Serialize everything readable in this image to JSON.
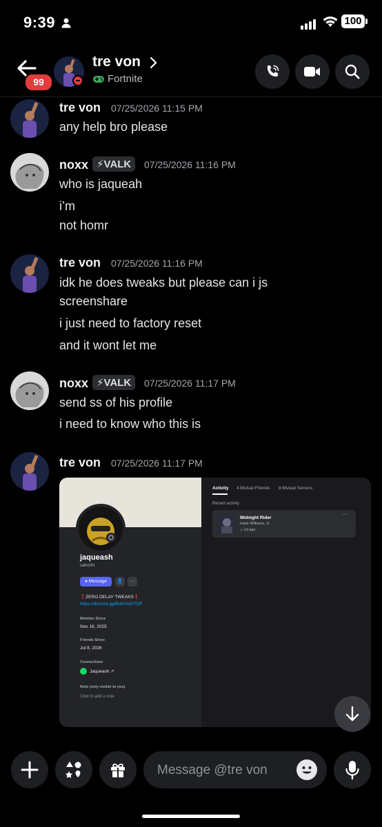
{
  "status_bar": {
    "time": "9:39",
    "battery": "100"
  },
  "header": {
    "unread_count": "99",
    "name": "tre von",
    "game": "Fortnite"
  },
  "messages": [
    {
      "author": "tre von",
      "timestamp": "07/25/2026 11:15 PM",
      "lines": [
        "any help bro please"
      ]
    },
    {
      "author": "noxx",
      "tag": "VALK",
      "timestamp": "07/25/2026 11:16 PM",
      "lines": [
        "who is jaqueah",
        "i’m",
        "not homr"
      ]
    },
    {
      "author": "tre von",
      "timestamp": "07/25/2026 11:16 PM",
      "lines": [
        "idk he does tweaks but please can i js",
        "screenshare",
        "i just need to factory reset",
        "and it wont let me"
      ]
    },
    {
      "author": "noxx",
      "tag": "VALK",
      "timestamp": "07/25/2026 11:17 PM",
      "lines": [
        "send ss of his profile",
        "i need to know who this is"
      ]
    },
    {
      "author": "tre von",
      "timestamp": "07/25/2026 11:17 PM",
      "lines": []
    }
  ],
  "attachment": {
    "profile_name": "jaqueash",
    "username": "sahcrfn",
    "message_button": "Message",
    "bio": "ZERO DELAY TWEAKS",
    "link": "https://discord.gg/BuKrVqVTDF",
    "member_since_label": "Member Since",
    "member_since": "Nov 16, 2025",
    "friends_since_label": "Friends Since",
    "friends_since": "Jul 8, 2026",
    "connections_label": "Connections",
    "connection": "Jaqueash ↗",
    "note_label": "Note (only visible to you)",
    "note_placeholder": "Click to add a note",
    "tabs": [
      "Activity",
      "4 Mutual Friends",
      "8 Mutual Servers"
    ],
    "recent_label": "Recent activity",
    "song": "Midnight Rider",
    "artist": "Hank Williams, Jr.",
    "ago": "1d ago"
  },
  "composer": {
    "placeholder": "Message @tre von"
  }
}
